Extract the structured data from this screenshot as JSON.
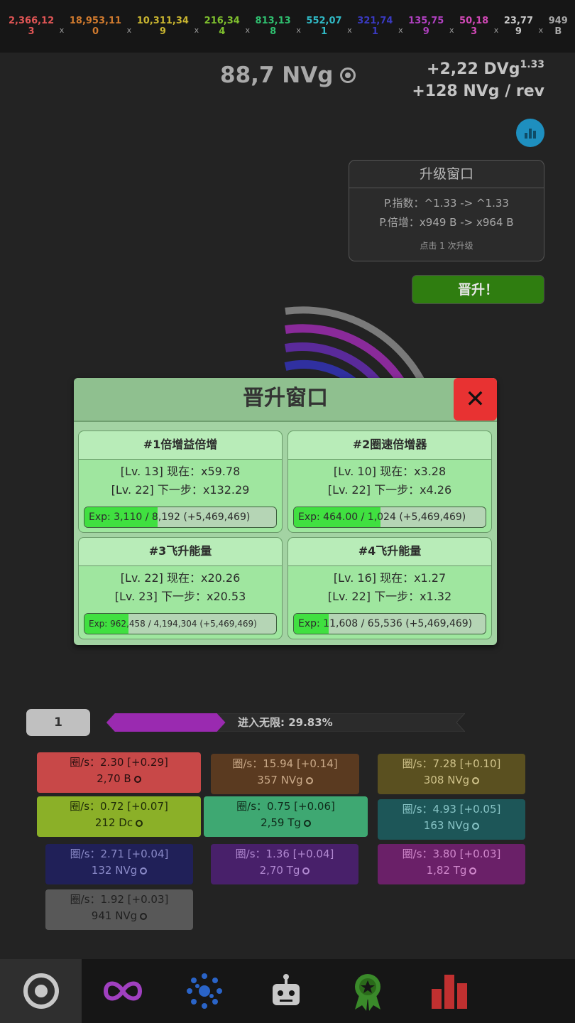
{
  "multipliers": [
    {
      "top": "2,366,12",
      "bot": "3",
      "color": "#e05555"
    },
    {
      "top": "18,953,11",
      "bot": "0",
      "color": "#d07a2e"
    },
    {
      "top": "10,311,34",
      "bot": "9",
      "color": "#c9b530"
    },
    {
      "top": "216,34",
      "bot": "4",
      "color": "#7fc02e"
    },
    {
      "top": "813,13",
      "bot": "8",
      "color": "#2fbf6f"
    },
    {
      "top": "552,07",
      "bot": "1",
      "color": "#30b9c5"
    },
    {
      "top": "321,74",
      "bot": "1",
      "color": "#3a3ac2"
    },
    {
      "top": "135,75",
      "bot": "9",
      "color": "#b040c0"
    },
    {
      "top": "50,18",
      "bot": "3",
      "color": "#d048b5"
    },
    {
      "top": "23,77",
      "bot": "9",
      "color": "#c8c8c8"
    },
    {
      "top": "949",
      "bot": "B",
      "color": "#a8a8a8"
    }
  ],
  "separator": "x",
  "currency": "88,7 NVg",
  "rates": {
    "line1": "+2,22 DVg",
    "line1_exp": "1.33",
    "line2": "+128 NVg / rev"
  },
  "upgrade_window": {
    "title": "升级窗口",
    "line1": "P.指数：^1.33 -> ^1.33",
    "line2": "P.倍增：x949 B -> x964 B",
    "hint": "点击 1 次升级"
  },
  "promote_button": "晋升！",
  "modal": {
    "title": "晋升窗口",
    "close": "✕",
    "cards": [
      {
        "title": "#1倍增益倍增",
        "now": "[Lv. 13] 现在：x59.78",
        "next": "[Lv. 22] 下一步：x132.29",
        "exp": "Exp: 3,110 / 8,192 (+5,469,469)",
        "fill": 0.38
      },
      {
        "title": "#2圈速倍增器",
        "now": "[Lv. 10] 现在：x3.28",
        "next": "[Lv. 22] 下一步：x4.26",
        "exp": "Exp: 464.00 / 1,024 (+5,469,469)",
        "fill": 0.45
      },
      {
        "title": "#3飞升能量",
        "now": "[Lv. 22] 现在：x20.26",
        "next": "[Lv. 23] 下一步：x20.53",
        "exp": "Exp: 962,458 / 4,194,304 (+5,469,469)",
        "fill": 0.23
      },
      {
        "title": "#4飞升能量",
        "now": "[Lv. 16] 现在：x1.27",
        "next": "[Lv. 22] 下一步：x1.32",
        "exp": "Exp: 11,608 / 65,536 (+5,469,469)",
        "fill": 0.18
      }
    ]
  },
  "level": "1",
  "progress": {
    "label": "进入无限: 29.83%",
    "value": 0.2983
  },
  "tiles": [
    {
      "rate": "圈/s：2.30 [+0.29]",
      "amount": "2,70 B",
      "bg": "#c84848",
      "fg": "#2a1010"
    },
    {
      "rate": "圈/s：15.94 [+0.14]",
      "amount": "357 NVg",
      "bg": "#5a3a20",
      "fg": "#c9a988"
    },
    {
      "rate": "圈/s：7.28 [+0.10]",
      "amount": "308 NVg",
      "bg": "#5a5020",
      "fg": "#cfc28a"
    },
    {
      "rate": "圈/s：0.72 [+0.07]",
      "amount": "212 Dc",
      "bg": "#8bb028",
      "fg": "#1e2a08"
    },
    {
      "rate": "圈/s：0.75 [+0.06]",
      "amount": "2,59 Tg",
      "bg": "#3ea872",
      "fg": "#0f2a1a"
    },
    {
      "rate": "圈/s：4.93 [+0.05]",
      "amount": "163 NVg",
      "bg": "#1d5658",
      "fg": "#88c4c6"
    },
    {
      "rate": "圈/s：2.71 [+0.04]",
      "amount": "132 NVg",
      "bg": "#202058",
      "fg": "#8a8ac8"
    },
    {
      "rate": "圈/s：1.36 [+0.04]",
      "amount": "2,70 Tg",
      "bg": "#48206a",
      "fg": "#b088d0"
    },
    {
      "rate": "圈/s：3.80 [+0.03]",
      "amount": "1,82 Tg",
      "bg": "#6a2068",
      "fg": "#d088cc"
    },
    {
      "rate": "圈/s：1.92 [+0.03]",
      "amount": "941 NVg",
      "bg": "#585858",
      "fg": "#202020"
    }
  ],
  "nav": [
    {
      "name": "nav-rings",
      "icon": "ring-icon",
      "color": "#c8c8c8"
    },
    {
      "name": "nav-infinity",
      "icon": "infinity-icon",
      "color": "#a040c0"
    },
    {
      "name": "nav-dots",
      "icon": "dots-icon",
      "color": "#2a64c8"
    },
    {
      "name": "nav-robot",
      "icon": "robot-icon",
      "color": "#c8c8c8"
    },
    {
      "name": "nav-medal",
      "icon": "medal-icon",
      "color": "#3a8a2a"
    },
    {
      "name": "nav-stats",
      "icon": "stats-icon",
      "color": "#c03030"
    },
    {
      "name": "nav-extra",
      "icon": "blank-icon",
      "color": "#1a1a1a"
    }
  ]
}
